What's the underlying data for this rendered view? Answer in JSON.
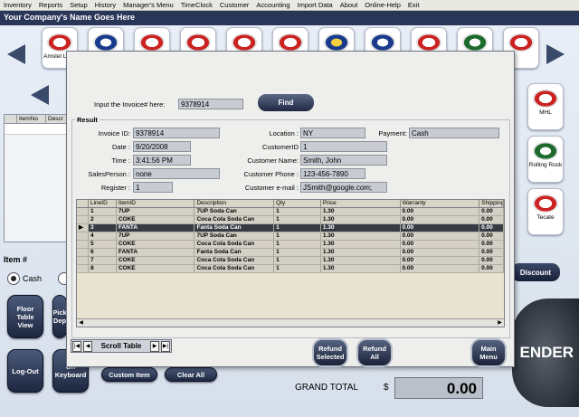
{
  "menu": [
    "Inventory",
    "Reports",
    "Setup",
    "History",
    "Manager's Menu",
    "TimeClock",
    "Customer",
    "Accounting",
    "Import Data",
    "About",
    "Online-Help",
    "Exit"
  ],
  "company_title": "Your Company's Name Goes Here",
  "products_top": [
    {
      "label": "Amstel Light",
      "icon": "amstel-logo-icon"
    },
    {
      "label": "",
      "icon": "bud-light-logo-icon"
    },
    {
      "label": "",
      "icon": "budweiser-logo-icon"
    },
    {
      "label": "",
      "icon": "beer-logo-icon"
    },
    {
      "label": "",
      "icon": "beer-logo-icon"
    },
    {
      "label": "",
      "icon": "beer-logo-icon"
    },
    {
      "label": "",
      "icon": "corona-logo-icon"
    },
    {
      "label": "",
      "icon": "beer-logo-icon"
    },
    {
      "label": "",
      "icon": "beer-logo-icon"
    },
    {
      "label": "",
      "icon": "heineken-logo-icon"
    },
    {
      "label": "",
      "icon": "beer-logo-icon"
    }
  ],
  "products_side": [
    {
      "label": "MHL",
      "icon": "miller-logo-icon"
    },
    {
      "label": "Rolling Rock",
      "icon": "rolling-rock-logo-icon"
    },
    {
      "label": "Tecate",
      "icon": "tecate-logo-icon"
    }
  ],
  "bg_grid": {
    "col_itemno": "ItemNo",
    "col_desc": "Descr"
  },
  "item_label": "Item #",
  "payment_radio_label": "Cash",
  "bg_buttons": {
    "floor_table_view": "Floor Table View",
    "pick_dept": "Pick Dep",
    "log_out": "Log-Out",
    "on_keyboard": "On Keyboard",
    "custom_item": "Custom Item",
    "clear_all": "Clear All",
    "discount": "Discount",
    "tender": "ENDER"
  },
  "grand_total": {
    "label": "GRAND TOTAL",
    "currency": "$",
    "value": "0.00"
  },
  "dialog": {
    "invoice_prompt": "Input the Invoice# here:",
    "invoice_input": "9378914",
    "find": "Find",
    "result": "Result",
    "fields": {
      "invoice_id_label": "Invoice ID:",
      "invoice_id": "9378914",
      "date_label": "Date :",
      "date": "9/20/2008",
      "time_label": "Time :",
      "time": "3:41:56 PM",
      "salesperson_label": "SalesPerson :",
      "salesperson": "none",
      "register_label": "Register :",
      "register": "1",
      "location_label": "Location :",
      "location": "NY",
      "payment_label": "Payment:",
      "payment": "Cash",
      "customer_id_label": "CustomerID",
      "customer_id": "1",
      "customer_name_label": "Customer Name:",
      "customer_name": "Smith, John",
      "customer_phone_label": "Customer Phone :",
      "customer_phone": "123-456-7890",
      "customer_email_label": "Customer e-mail :",
      "customer_email": "JSmith@google.com;"
    },
    "table": {
      "columns": [
        "LineID",
        "ItemID",
        "Description",
        "Qty",
        "Price",
        "Warranty",
        "Shipping"
      ],
      "rows": [
        [
          "1",
          "7UP",
          "7UP Soda Can",
          "1",
          "1.30",
          "0.00",
          "0.00"
        ],
        [
          "2",
          "COKE",
          "Coca Cola Soda Can",
          "1",
          "1.30",
          "0.00",
          "0.00"
        ],
        [
          "3",
          "FANTA",
          "Fanta Soda Can",
          "1",
          "1.30",
          "0.00",
          "0.00"
        ],
        [
          "4",
          "7UP",
          "7UP Soda Can",
          "1",
          "1.30",
          "0.00",
          "0.00"
        ],
        [
          "5",
          "COKE",
          "Coca Cola Soda Can",
          "1",
          "1.30",
          "0.00",
          "0.00"
        ],
        [
          "6",
          "FANTA",
          "Fanta Soda Can",
          "1",
          "1.30",
          "0.00",
          "0.00"
        ],
        [
          "7",
          "COKE",
          "Coca Cola Soda Can",
          "1",
          "1.30",
          "0.00",
          "0.00"
        ],
        [
          "8",
          "COKE",
          "Coca Cola Soda Can",
          "1",
          "1.30",
          "0.00",
          "0.00"
        ]
      ],
      "selected_row": 2
    },
    "scroll_table": "Scroll Table",
    "refund_selected": "Refund Selected",
    "refund_all": "Refund All",
    "main_menu": "Main Menu"
  }
}
